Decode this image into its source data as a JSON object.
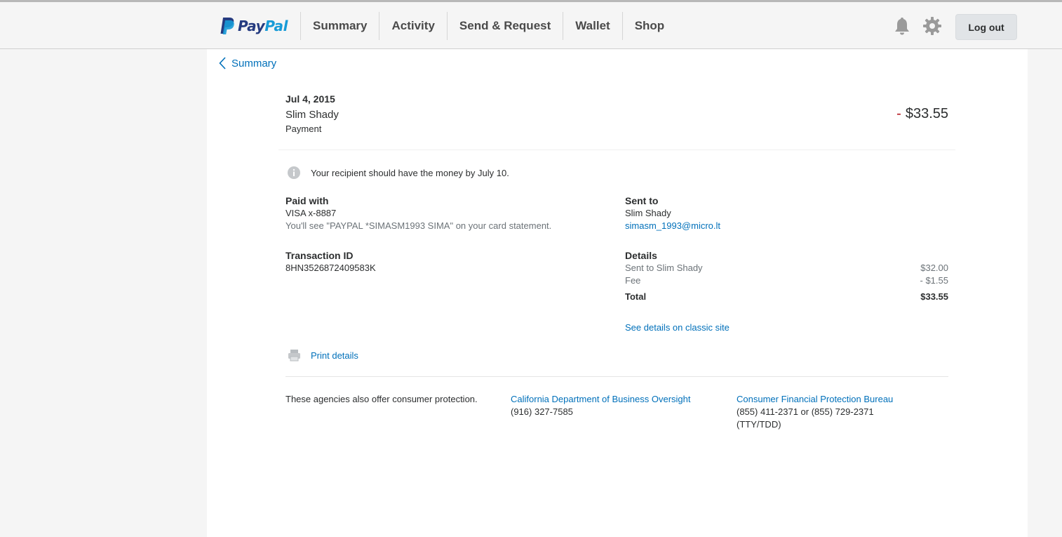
{
  "header": {
    "logo": {
      "pay": "Pay",
      "pal": "Pal"
    },
    "nav": [
      "Summary",
      "Activity",
      "Send & Request",
      "Wallet",
      "Shop"
    ],
    "logout_label": "Log out",
    "icons": [
      "bell-icon",
      "gear-icon"
    ]
  },
  "back_link": "Summary",
  "transaction": {
    "date": "Jul 4, 2015",
    "name": "Slim Shady",
    "type": "Payment",
    "amount_sign": "-",
    "amount": "$33.55"
  },
  "notice": "Your recipient should have the money by July 10.",
  "paid_with": {
    "label": "Paid with",
    "method": "VISA x-8887",
    "statement_note": "You'll see \"PAYPAL *SIMASM1993 SIMA\" on your card statement."
  },
  "sent_to": {
    "label": "Sent to",
    "name": "Slim Shady",
    "email": "simasm_1993@micro.lt"
  },
  "transaction_id": {
    "label": "Transaction ID",
    "value": "8HN3526872409583K"
  },
  "details": {
    "label": "Details",
    "rows": [
      {
        "label": "Sent to Slim Shady",
        "value": "$32.00"
      },
      {
        "label": "Fee",
        "value": "- $1.55"
      }
    ],
    "total_label": "Total",
    "total_value": "$33.55",
    "classic_link": "See details on classic site"
  },
  "print_label": "Print details",
  "agencies": {
    "intro": "These agencies also offer consumer protection.",
    "agency1": {
      "name": "California Department of Business Oversight",
      "phone": "(916) 327-7585"
    },
    "agency2": {
      "name": "Consumer Financial Protection Bureau",
      "phone": "(855) 411-2371 or (855) 729-2371",
      "phone2": "(TTY/TDD)"
    }
  },
  "colors": {
    "link": "#0070ba",
    "negative": "#b3131b",
    "brand_dark": "#253b80",
    "brand_light": "#179bd7"
  }
}
